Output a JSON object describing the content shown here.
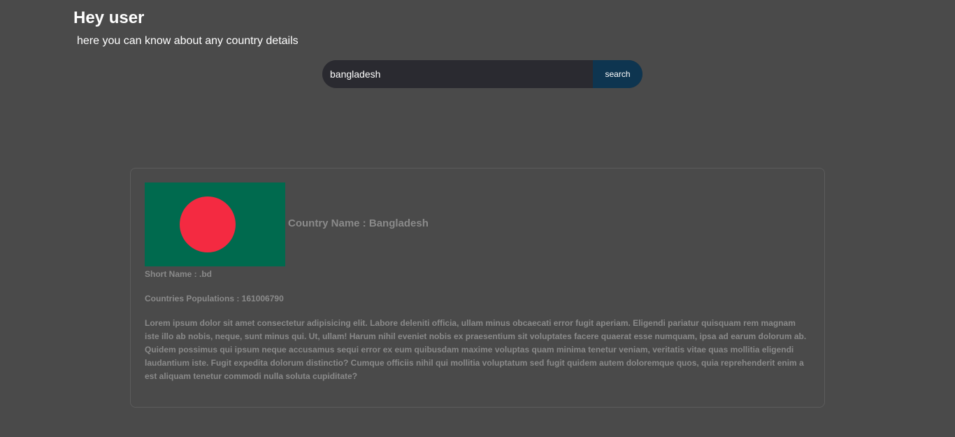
{
  "header": {
    "greeting": "Hey user",
    "subtitle": "here you can know about any country details"
  },
  "search": {
    "value": "bangladesh",
    "button_label": "search"
  },
  "country": {
    "flag_icon": "bangladesh-flag",
    "flag_colors": {
      "field": "#006a4e",
      "disc": "#f42a41"
    },
    "name_label": "Country Name : ",
    "name": "Bangladesh",
    "short_name_label": "Short Name : ",
    "short_name": ".bd",
    "population_label": "Countries Populations : ",
    "population": "161006790",
    "description": "Lorem ipsum dolor sit amet consectetur adipisicing elit. Labore deleniti officia, ullam minus obcaecati error fugit aperiam. Eligendi pariatur quisquam rem magnam iste illo ab nobis, neque, sunt minus qui. Ut, ullam! Harum nihil eveniet nobis ex praesentium sit voluptates facere quaerat esse numquam, ipsa ad earum dolorum ab. Quidem possimus qui ipsum neque accusamus sequi error ex eum quibusdam maxime voluptas quam minima tenetur veniam, veritatis vitae quas mollitia eligendi laudantium iste. Fugit expedita dolorum distinctio? Cumque officiis nihil qui mollitia voluptatum sed fugit quidem autem doloremque quos, quia reprehenderit enim a est aliquam tenetur commodi nulla soluta cupiditate?"
  },
  "colors": {
    "background": "#4a4a4a",
    "search_field": "#2a2a30",
    "search_button": "#0e3550",
    "muted_text": "#8a8a8a"
  }
}
